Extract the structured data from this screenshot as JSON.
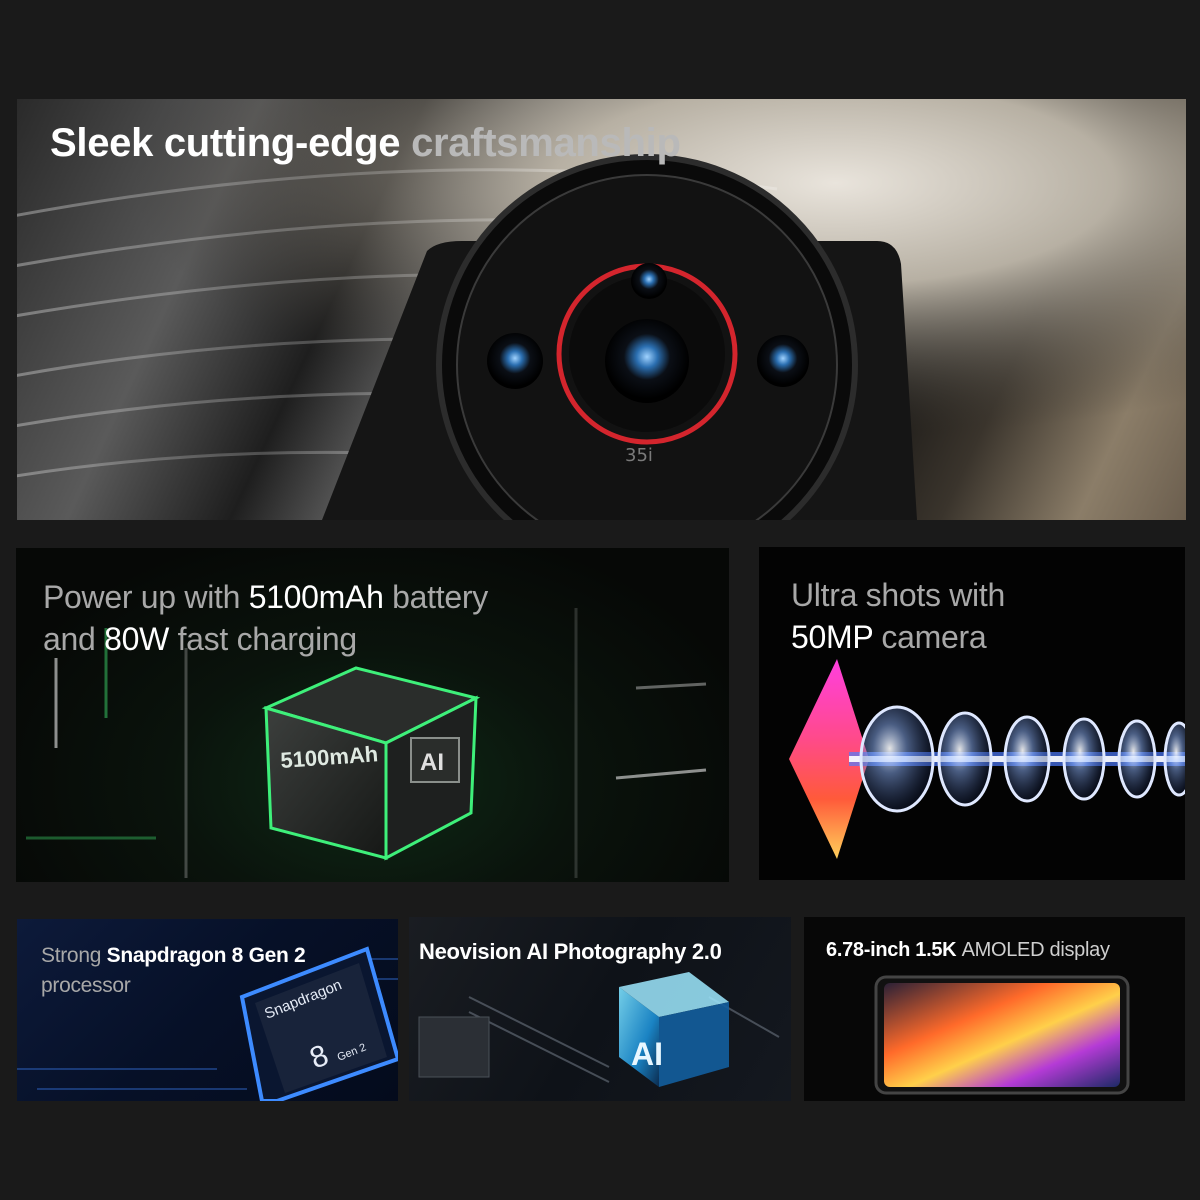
{
  "hero": {
    "title_bright": "Sleek cutting-edge",
    "title_dim": "craftsmanship",
    "lens_marking": "35i"
  },
  "battery": {
    "line1_dim": "Power up with",
    "line1_bright": "5100mAh",
    "line1_dim2": "battery",
    "line2_dim": "and",
    "line2_bright": "80W",
    "line2_dim2": "fast charging",
    "chip_label": "5100mAh",
    "chip_badge": "AI"
  },
  "camera": {
    "line1_dim": "Ultra shots with",
    "line2_bright": "50MP",
    "line2_dim": "camera"
  },
  "processor": {
    "line1_dim": "Strong",
    "line1_bright": "Snapdragon 8 Gen 2",
    "line2_dim": "processor",
    "chip_brand": "Snapdragon",
    "chip_num": "8",
    "chip_gen": "Gen 2"
  },
  "neovision": {
    "title": "Neovision AI Photography 2.0",
    "chip_badge": "AI"
  },
  "display": {
    "bright": "6.78-inch 1.5K",
    "dim": "AMOLED display"
  }
}
